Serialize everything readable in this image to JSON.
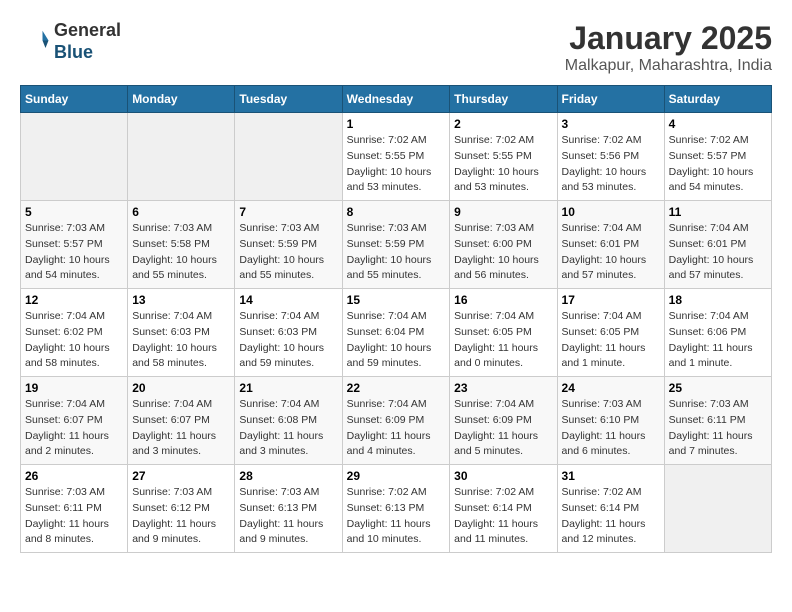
{
  "header": {
    "logo": {
      "line1": "General",
      "line2": "Blue"
    },
    "month": "January 2025",
    "location": "Malkapur, Maharashtra, India"
  },
  "weekdays": [
    "Sunday",
    "Monday",
    "Tuesday",
    "Wednesday",
    "Thursday",
    "Friday",
    "Saturday"
  ],
  "weeks": [
    [
      {
        "day": "",
        "sunrise": "",
        "sunset": "",
        "daylight": ""
      },
      {
        "day": "",
        "sunrise": "",
        "sunset": "",
        "daylight": ""
      },
      {
        "day": "",
        "sunrise": "",
        "sunset": "",
        "daylight": ""
      },
      {
        "day": "1",
        "sunrise": "Sunrise: 7:02 AM",
        "sunset": "Sunset: 5:55 PM",
        "daylight": "Daylight: 10 hours and 53 minutes."
      },
      {
        "day": "2",
        "sunrise": "Sunrise: 7:02 AM",
        "sunset": "Sunset: 5:55 PM",
        "daylight": "Daylight: 10 hours and 53 minutes."
      },
      {
        "day": "3",
        "sunrise": "Sunrise: 7:02 AM",
        "sunset": "Sunset: 5:56 PM",
        "daylight": "Daylight: 10 hours and 53 minutes."
      },
      {
        "day": "4",
        "sunrise": "Sunrise: 7:02 AM",
        "sunset": "Sunset: 5:57 PM",
        "daylight": "Daylight: 10 hours and 54 minutes."
      }
    ],
    [
      {
        "day": "5",
        "sunrise": "Sunrise: 7:03 AM",
        "sunset": "Sunset: 5:57 PM",
        "daylight": "Daylight: 10 hours and 54 minutes."
      },
      {
        "day": "6",
        "sunrise": "Sunrise: 7:03 AM",
        "sunset": "Sunset: 5:58 PM",
        "daylight": "Daylight: 10 hours and 55 minutes."
      },
      {
        "day": "7",
        "sunrise": "Sunrise: 7:03 AM",
        "sunset": "Sunset: 5:59 PM",
        "daylight": "Daylight: 10 hours and 55 minutes."
      },
      {
        "day": "8",
        "sunrise": "Sunrise: 7:03 AM",
        "sunset": "Sunset: 5:59 PM",
        "daylight": "Daylight: 10 hours and 55 minutes."
      },
      {
        "day": "9",
        "sunrise": "Sunrise: 7:03 AM",
        "sunset": "Sunset: 6:00 PM",
        "daylight": "Daylight: 10 hours and 56 minutes."
      },
      {
        "day": "10",
        "sunrise": "Sunrise: 7:04 AM",
        "sunset": "Sunset: 6:01 PM",
        "daylight": "Daylight: 10 hours and 57 minutes."
      },
      {
        "day": "11",
        "sunrise": "Sunrise: 7:04 AM",
        "sunset": "Sunset: 6:01 PM",
        "daylight": "Daylight: 10 hours and 57 minutes."
      }
    ],
    [
      {
        "day": "12",
        "sunrise": "Sunrise: 7:04 AM",
        "sunset": "Sunset: 6:02 PM",
        "daylight": "Daylight: 10 hours and 58 minutes."
      },
      {
        "day": "13",
        "sunrise": "Sunrise: 7:04 AM",
        "sunset": "Sunset: 6:03 PM",
        "daylight": "Daylight: 10 hours and 58 minutes."
      },
      {
        "day": "14",
        "sunrise": "Sunrise: 7:04 AM",
        "sunset": "Sunset: 6:03 PM",
        "daylight": "Daylight: 10 hours and 59 minutes."
      },
      {
        "day": "15",
        "sunrise": "Sunrise: 7:04 AM",
        "sunset": "Sunset: 6:04 PM",
        "daylight": "Daylight: 10 hours and 59 minutes."
      },
      {
        "day": "16",
        "sunrise": "Sunrise: 7:04 AM",
        "sunset": "Sunset: 6:05 PM",
        "daylight": "Daylight: 11 hours and 0 minutes."
      },
      {
        "day": "17",
        "sunrise": "Sunrise: 7:04 AM",
        "sunset": "Sunset: 6:05 PM",
        "daylight": "Daylight: 11 hours and 1 minute."
      },
      {
        "day": "18",
        "sunrise": "Sunrise: 7:04 AM",
        "sunset": "Sunset: 6:06 PM",
        "daylight": "Daylight: 11 hours and 1 minute."
      }
    ],
    [
      {
        "day": "19",
        "sunrise": "Sunrise: 7:04 AM",
        "sunset": "Sunset: 6:07 PM",
        "daylight": "Daylight: 11 hours and 2 minutes."
      },
      {
        "day": "20",
        "sunrise": "Sunrise: 7:04 AM",
        "sunset": "Sunset: 6:07 PM",
        "daylight": "Daylight: 11 hours and 3 minutes."
      },
      {
        "day": "21",
        "sunrise": "Sunrise: 7:04 AM",
        "sunset": "Sunset: 6:08 PM",
        "daylight": "Daylight: 11 hours and 3 minutes."
      },
      {
        "day": "22",
        "sunrise": "Sunrise: 7:04 AM",
        "sunset": "Sunset: 6:09 PM",
        "daylight": "Daylight: 11 hours and 4 minutes."
      },
      {
        "day": "23",
        "sunrise": "Sunrise: 7:04 AM",
        "sunset": "Sunset: 6:09 PM",
        "daylight": "Daylight: 11 hours and 5 minutes."
      },
      {
        "day": "24",
        "sunrise": "Sunrise: 7:03 AM",
        "sunset": "Sunset: 6:10 PM",
        "daylight": "Daylight: 11 hours and 6 minutes."
      },
      {
        "day": "25",
        "sunrise": "Sunrise: 7:03 AM",
        "sunset": "Sunset: 6:11 PM",
        "daylight": "Daylight: 11 hours and 7 minutes."
      }
    ],
    [
      {
        "day": "26",
        "sunrise": "Sunrise: 7:03 AM",
        "sunset": "Sunset: 6:11 PM",
        "daylight": "Daylight: 11 hours and 8 minutes."
      },
      {
        "day": "27",
        "sunrise": "Sunrise: 7:03 AM",
        "sunset": "Sunset: 6:12 PM",
        "daylight": "Daylight: 11 hours and 9 minutes."
      },
      {
        "day": "28",
        "sunrise": "Sunrise: 7:03 AM",
        "sunset": "Sunset: 6:13 PM",
        "daylight": "Daylight: 11 hours and 9 minutes."
      },
      {
        "day": "29",
        "sunrise": "Sunrise: 7:02 AM",
        "sunset": "Sunset: 6:13 PM",
        "daylight": "Daylight: 11 hours and 10 minutes."
      },
      {
        "day": "30",
        "sunrise": "Sunrise: 7:02 AM",
        "sunset": "Sunset: 6:14 PM",
        "daylight": "Daylight: 11 hours and 11 minutes."
      },
      {
        "day": "31",
        "sunrise": "Sunrise: 7:02 AM",
        "sunset": "Sunset: 6:14 PM",
        "daylight": "Daylight: 11 hours and 12 minutes."
      },
      {
        "day": "",
        "sunrise": "",
        "sunset": "",
        "daylight": ""
      }
    ]
  ]
}
